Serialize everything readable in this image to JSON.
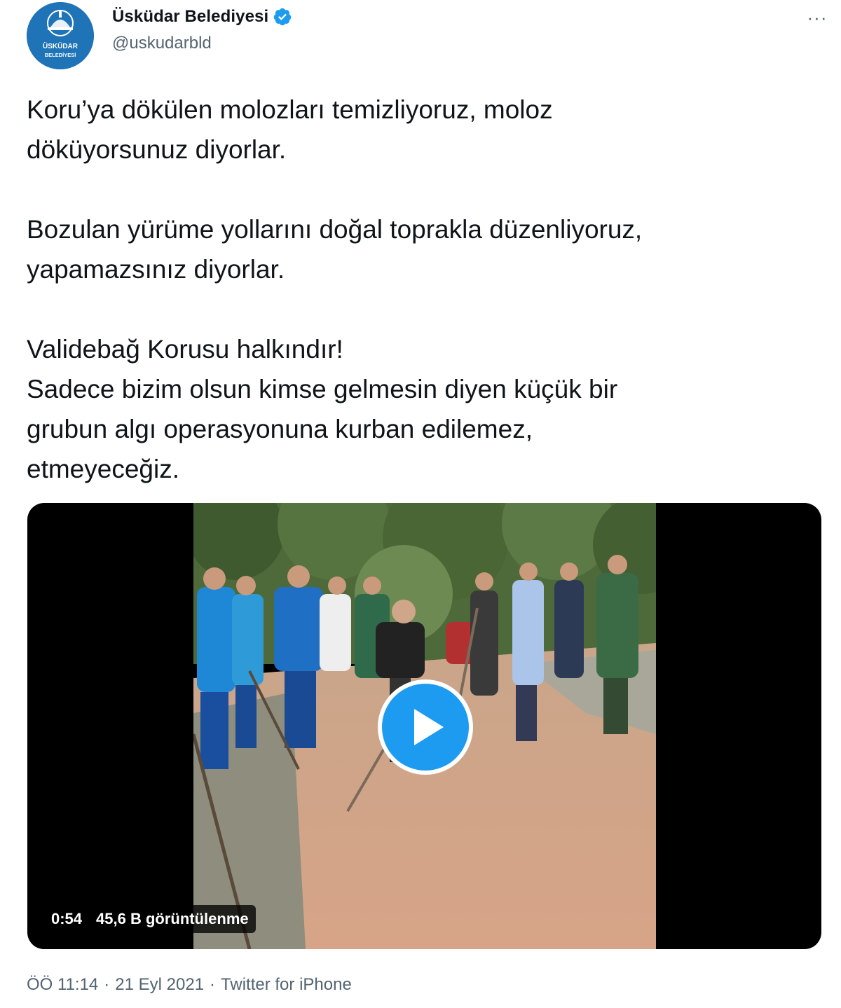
{
  "author": {
    "display_name": "Üsküdar Belediyesi",
    "handle": "@uskudarbld",
    "avatar_text_line1": "ÜSKÜDAR",
    "avatar_text_line2": "BELEDİYESİ",
    "verified": true
  },
  "more_label": "···",
  "tweet_text": {
    "p1_line1": "Koru’ya dökülen molozları temizliyoruz, moloz",
    "p1_line2": "döküyorsunuz diyorlar.",
    "p2_line1": "Bozulan yürüme yollarını doğal toprakla düzenliyoruz,",
    "p2_line2": "yapamazsınız diyorlar.",
    "p3_line1": "Validebağ Korusu halkındır!",
    "p3_line2": "Sadece bizim olsun kimse gelmesin diyen küçük bir",
    "p3_line3": "grubun algı operasyonuna kurban edilemez,",
    "p3_line4": "etmeyeceğiz."
  },
  "video": {
    "duration": "0:54",
    "views": "45,6 B görüntülenme",
    "play_icon": "play-icon"
  },
  "meta": {
    "time": "ÖÖ 11:14",
    "separator": "·",
    "date": "21 Eyl 2021",
    "source": "Twitter for iPhone"
  },
  "colors": {
    "accent": "#1d9bf0",
    "text": "#0f1419",
    "secondary": "#536471",
    "avatar_bg": "#1f73b7"
  }
}
